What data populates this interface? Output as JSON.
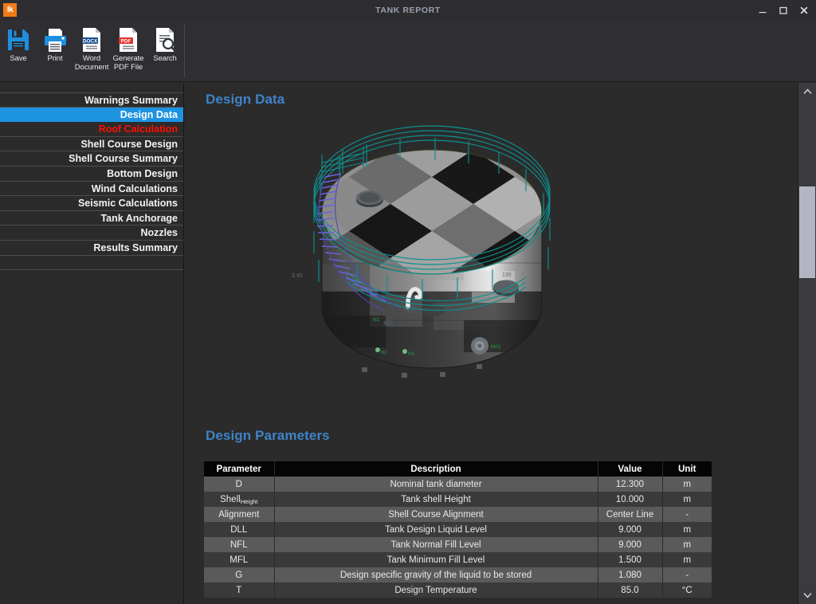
{
  "window": {
    "app_icon_text": "Ik",
    "title": "TANK REPORT",
    "controls": [
      {
        "name": "minimize",
        "label": "–"
      },
      {
        "name": "maximize",
        "label": "❐"
      },
      {
        "name": "close",
        "label": "✕"
      }
    ]
  },
  "toolbar": {
    "items": [
      {
        "icon": "save-icon",
        "label": "Save"
      },
      {
        "icon": "printer-icon",
        "label": "Print"
      },
      {
        "icon": "word-document-icon",
        "label": "Word\nDocument",
        "line1": "Word",
        "line2": "Document",
        "badge": "DOCX"
      },
      {
        "icon": "pdf-file-icon",
        "label": "Generate\nPDF File",
        "line1": "Generate",
        "line2": "PDF File",
        "badge": "PDF"
      },
      {
        "icon": "search-document-icon",
        "label": "Search"
      }
    ]
  },
  "sidebar": {
    "items": [
      {
        "label": "Warnings Summary",
        "state": "normal"
      },
      {
        "label": "Design Data",
        "state": "selected"
      },
      {
        "label": "Roof Calculation",
        "state": "warning"
      },
      {
        "label": "Shell Course Design",
        "state": "normal"
      },
      {
        "label": "Shell Course Summary",
        "state": "normal"
      },
      {
        "label": "Bottom Design",
        "state": "normal"
      },
      {
        "label": "Wind Calculations",
        "state": "normal"
      },
      {
        "label": "Seismic Calculations",
        "state": "normal"
      },
      {
        "label": "Tank Anchorage",
        "state": "normal"
      },
      {
        "label": "Nozzles",
        "state": "normal"
      },
      {
        "label": "Results Summary",
        "state": "normal"
      }
    ]
  },
  "content": {
    "heading_design_data": "Design Data",
    "heading_design_parameters": "Design Parameters",
    "figure": {
      "name": "tank-3d-view",
      "nozzle_labels": [
        "V1",
        "N1",
        "N2",
        "N3",
        "M01"
      ],
      "dimension_labels": [
        "3.45",
        "135"
      ]
    },
    "table": {
      "columns": [
        "Parameter",
        "Description",
        "Value",
        "Unit"
      ],
      "rows": [
        {
          "parameter": "D",
          "sub": "",
          "description": "Nominal tank diameter",
          "value": "12.300",
          "unit": "m"
        },
        {
          "parameter": "Shell",
          "sub": "Height",
          "description": "Tank shell Height",
          "value": "10.000",
          "unit": "m"
        },
        {
          "parameter": "Alignment",
          "sub": "",
          "description": "Shell Course Alignment",
          "value": "Center Line",
          "unit": "-"
        },
        {
          "parameter": "DLL",
          "sub": "",
          "description": "Tank Design Liquid Level",
          "value": "9.000",
          "unit": "m"
        },
        {
          "parameter": "NFL",
          "sub": "",
          "description": "Tank Normal Fill Level",
          "value": "9.000",
          "unit": "m"
        },
        {
          "parameter": "MFL",
          "sub": "",
          "description": "Tank Minimum Fill Level",
          "value": "1.500",
          "unit": "m"
        },
        {
          "parameter": "G",
          "sub": "",
          "description": "Design specific gravity of the liquid to be stored",
          "value": "1.080",
          "unit": "-"
        },
        {
          "parameter": "T",
          "sub": "",
          "description": "Design Temperature",
          "value": "85.0",
          "unit": "°C"
        }
      ]
    }
  },
  "scrollbar": {
    "up_arrow": "▲",
    "down_arrow": "▼"
  },
  "colors": {
    "accent_selected": "#1e93e0",
    "warning_text": "#ff0f00",
    "heading_blue": "#3f83c9",
    "app_icon_orange": "#f07c18",
    "window_bg": "#2b2b2b"
  }
}
